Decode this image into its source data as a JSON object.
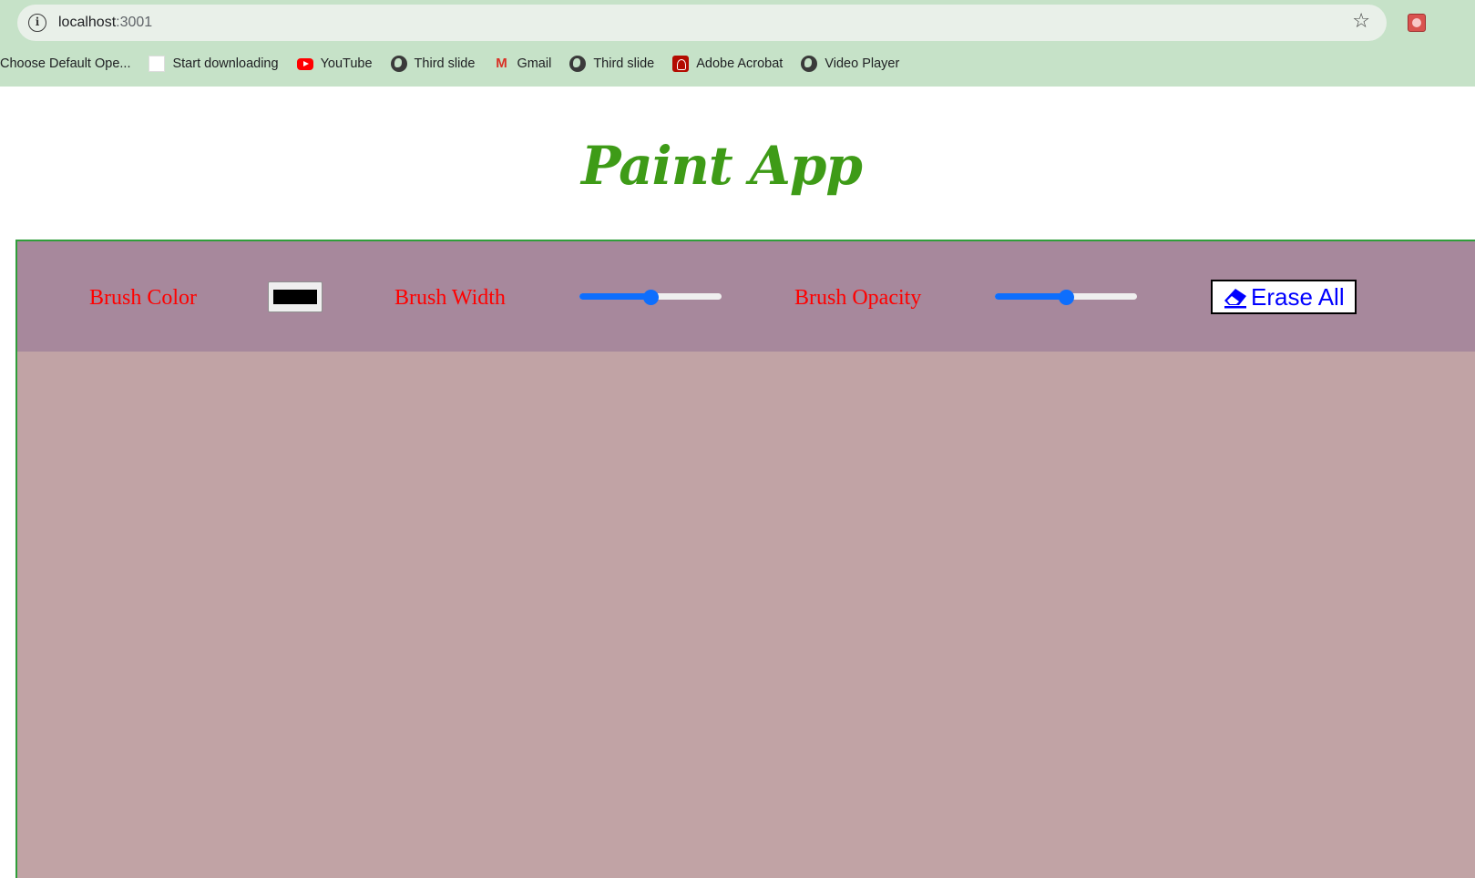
{
  "browser": {
    "url_host": "localhost",
    "url_port": ":3001",
    "bookmarks": [
      {
        "label": "Choose Default Ope...",
        "icon": "none"
      },
      {
        "label": "Start downloading",
        "icon": "blank-page-icon"
      },
      {
        "label": "YouTube",
        "icon": "youtube-icon"
      },
      {
        "label": "Third slide",
        "icon": "globe-icon"
      },
      {
        "label": "Gmail",
        "icon": "gmail-icon"
      },
      {
        "label": "Third slide",
        "icon": "globe-icon"
      },
      {
        "label": "Adobe Acrobat",
        "icon": "acrobat-icon"
      },
      {
        "label": "Video Player",
        "icon": "globe-icon"
      }
    ]
  },
  "app": {
    "title": "Paint App",
    "toolbar": {
      "brush_color_label": "Brush Color",
      "brush_color_value": "#000000",
      "brush_width_label": "Brush Width",
      "brush_width_level": 0.5,
      "brush_opacity_label": "Brush Opacity",
      "brush_opacity_level": 0.5,
      "erase_label": "Erase All"
    },
    "colors": {
      "title": "#3e9b17",
      "toolbar_bg": "#a7889c",
      "canvas_bg": "#c1a3a5",
      "label_text": "#ff0000",
      "slider_accent": "#0d6efd",
      "erase_text": "#0000ff"
    }
  }
}
